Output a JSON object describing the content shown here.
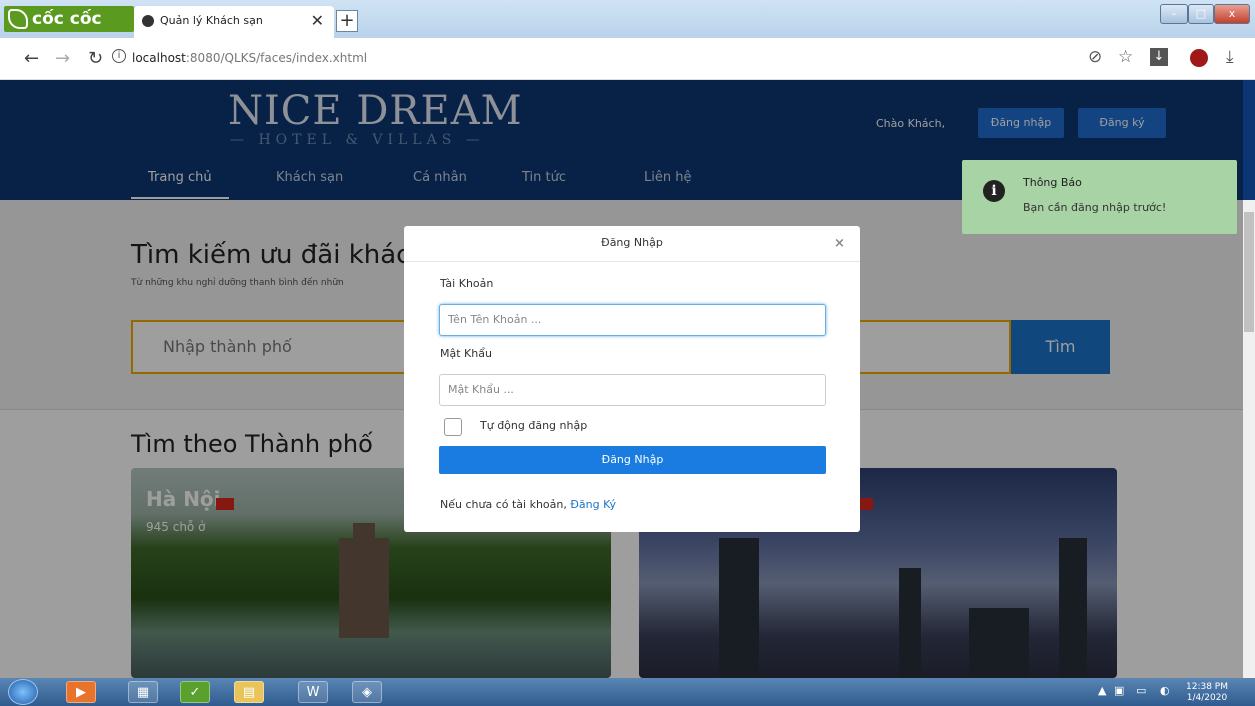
{
  "browser": {
    "brand": "cốc cốc",
    "tab_title": "Quản lý Khách sạn",
    "tab_close": "✕",
    "new_tab": "+",
    "url_host": "localhost",
    "url_path": ":8080/QLKS/faces/index.xhtml",
    "win_min": "–",
    "win_max": "□",
    "win_close": "x"
  },
  "site": {
    "logo_main": "NICE DREAM",
    "logo_sub": "— HOTEL & VILLAS —",
    "greeting": "Chào Khách,",
    "login_btn": "Đăng nhập",
    "register_btn": "Đăng ký",
    "menu": [
      "Trang chủ",
      "Khách sạn",
      "Cá nhân",
      "Tin tức",
      "Liên hệ"
    ]
  },
  "search": {
    "heading": "Tìm kiếm ưu đãi khách",
    "subheading": "Từ những khu nghỉ dưỡng thanh bình đến nhữn",
    "placeholder": "Nhập thành phố",
    "button": "Tìm"
  },
  "cities": {
    "heading": "Tìm theo Thành phố",
    "items": [
      {
        "name": "Hà Nội",
        "count": "945 chỗ ở"
      }
    ]
  },
  "modal": {
    "title": "Đăng Nhập",
    "close": "×",
    "username_label": "Tài Khoản",
    "username_placeholder": "Tên Tên Khoản ...",
    "password_label": "Mật Khẩu",
    "password_placeholder": "Mật Khẩu ...",
    "remember_label": "Tự động đăng nhập",
    "submit": "Đăng Nhập",
    "register_prompt": "Nếu chưa có tài khoản,",
    "register_link": "Đăng Ký"
  },
  "toast": {
    "icon": "i",
    "title": "Thông Báo",
    "message": "Bạn cần đăng nhập trước!"
  },
  "taskbar": {
    "time": "12:38 PM",
    "date": "1/4/2020"
  },
  "colors": {
    "header_bg": "#0c3673",
    "accent": "#1a73c9",
    "search_border": "#f0a800",
    "toast_bg": "#a8d3a4"
  }
}
